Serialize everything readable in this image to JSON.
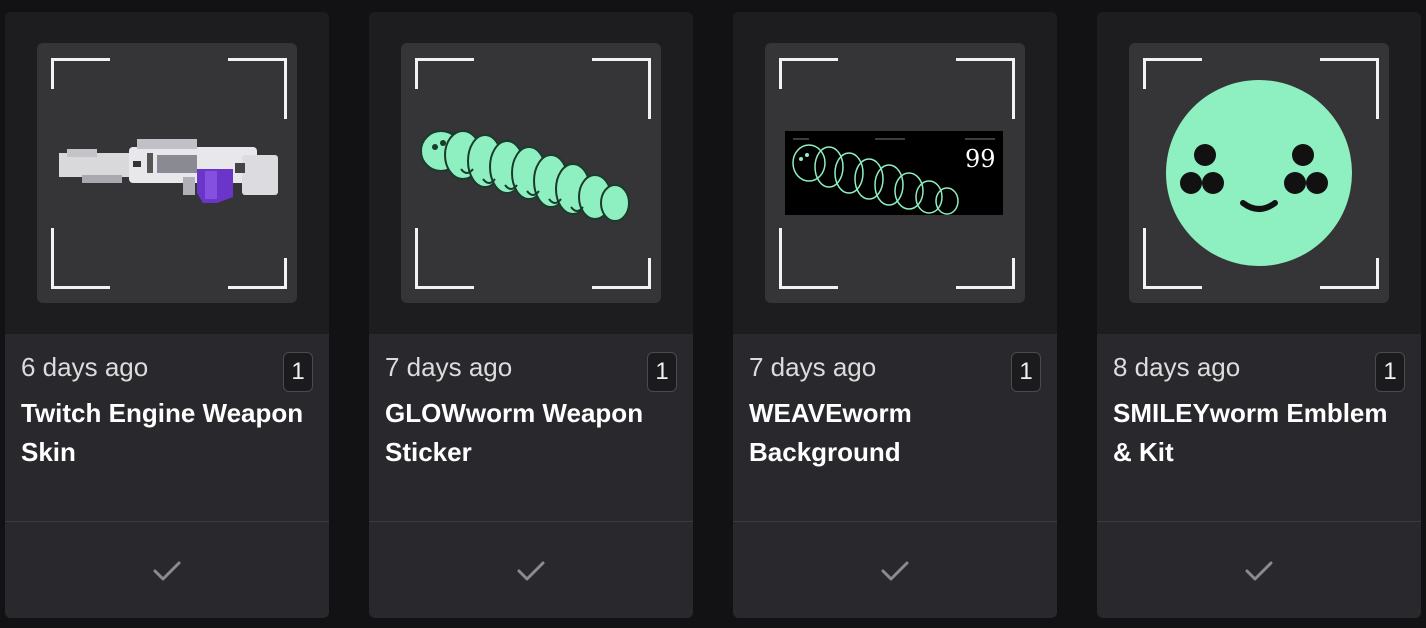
{
  "cards": [
    {
      "time": "6 days ago",
      "count": "1",
      "title": "Twitch Engine Weapon Skin",
      "thumbnail_icon": "weapon-skin-image",
      "check_icon": "check-icon"
    },
    {
      "time": "7 days ago",
      "count": "1",
      "title": "GLOWworm Weapon Sticker",
      "thumbnail_icon": "caterpillar-sticker-image",
      "check_icon": "check-icon"
    },
    {
      "time": "7 days ago",
      "count": "1",
      "title": "WEAVEworm Background",
      "thumbnail_icon": "caterpillar-background-image",
      "background_text": "99",
      "check_icon": "check-icon"
    },
    {
      "time": "8 days ago",
      "count": "1",
      "title": "SMILEYworm Emblem & Kit",
      "thumbnail_icon": "smiley-emblem-image",
      "check_icon": "check-icon"
    }
  ],
  "colors": {
    "page_background": "#121214",
    "card_background": "#202023",
    "info_background": "#29292d",
    "thumbnail_background": "#353538",
    "accent_mint": "#8ef0c0",
    "accent_purple": "#6a35c8"
  }
}
